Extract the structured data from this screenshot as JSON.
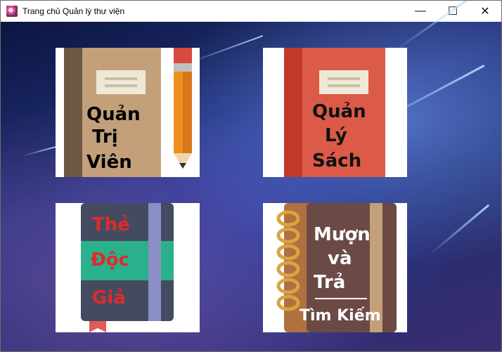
{
  "window": {
    "title": "Trang chủ Quản lý thư viện",
    "app_icon": "flower-app-icon",
    "controls": {
      "minimize": "—",
      "maximize": "☐",
      "close": "✕"
    }
  },
  "tiles": [
    {
      "id": "admin",
      "lines": [
        "Quản",
        "Trị",
        "Viên"
      ],
      "icon": "notebook-pencil-icon",
      "text_color": "#000000"
    },
    {
      "id": "books",
      "lines": [
        "Quản",
        "Lý",
        "Sách"
      ],
      "icon": "red-book-icon",
      "text_color": "#111111"
    },
    {
      "id": "readers",
      "lines": [
        "Thẻ",
        "Độc",
        "Giả"
      ],
      "icon": "reader-card-book-icon",
      "text_color": "#e02a2a"
    },
    {
      "id": "borrow",
      "lines": [
        "Mượn",
        "và",
        "Trả"
      ],
      "footer": "Tìm Kiếm",
      "icon": "spiral-notebook-icon",
      "text_color": "#ffffff"
    }
  ]
}
